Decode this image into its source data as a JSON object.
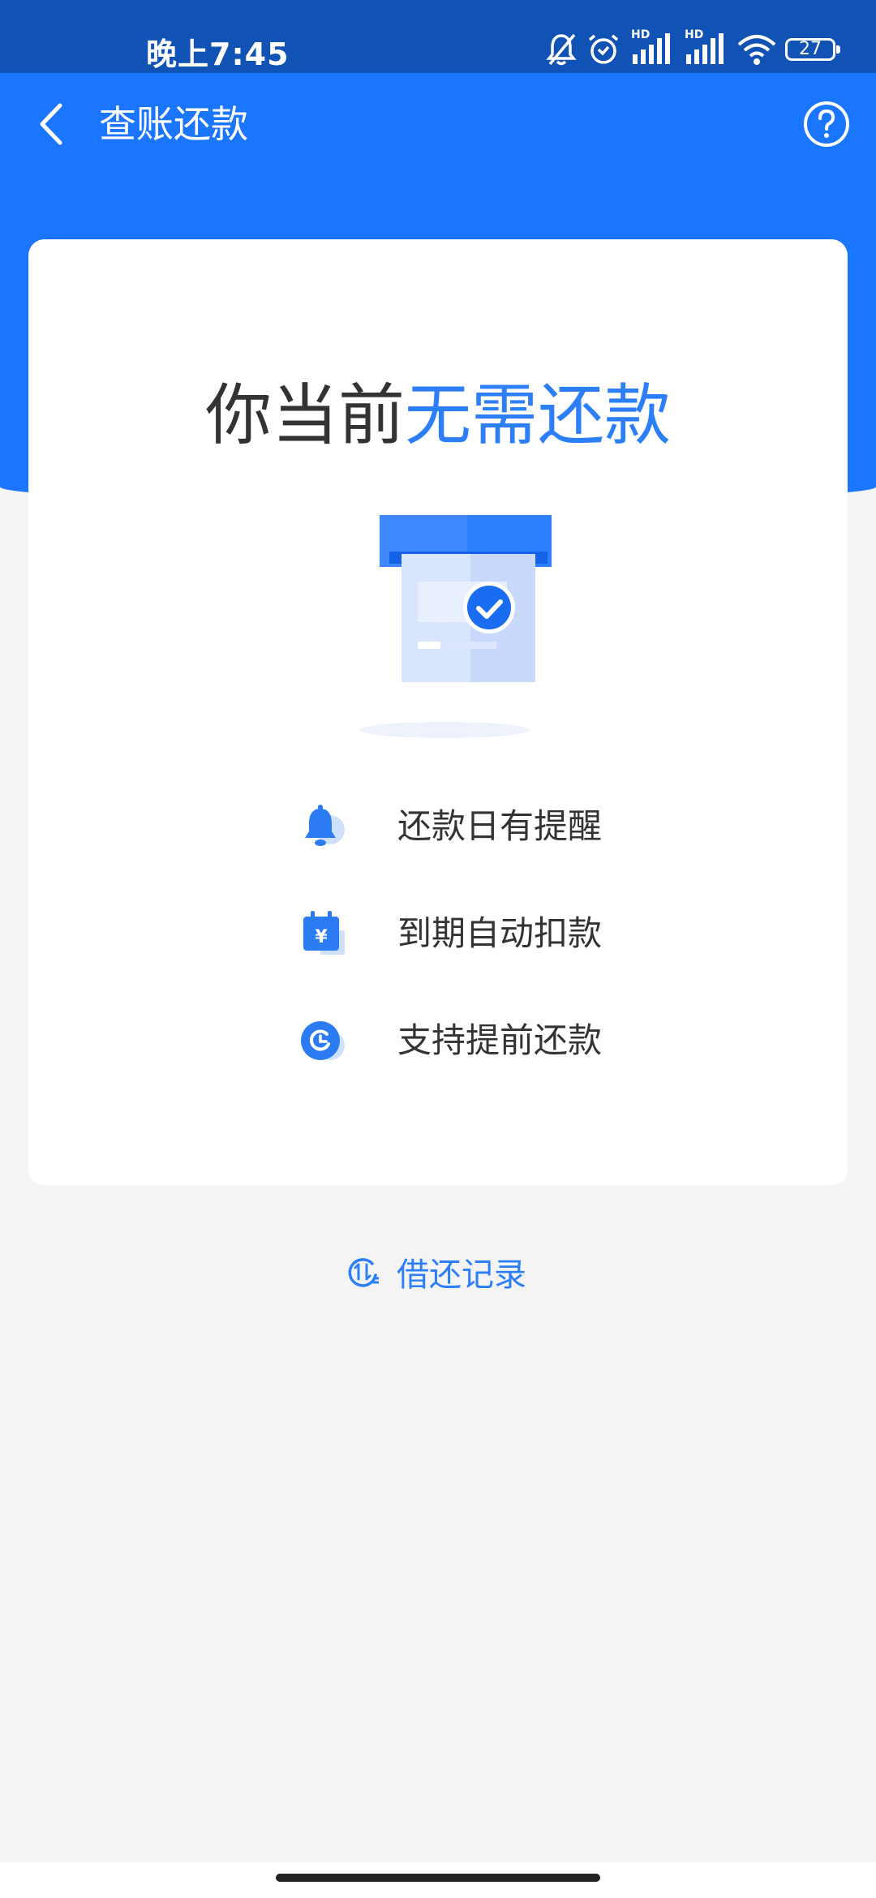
{
  "status_bar": {
    "time": "晚上7:45",
    "icons": [
      "bell-off-icon",
      "alarm-icon",
      "signal-hd-icon",
      "signal-hd-icon",
      "wifi-icon",
      "battery-icon"
    ],
    "hd_label": "HD",
    "battery_level": "27"
  },
  "header": {
    "title": "查账还款",
    "back_icon": "back-arrow-icon",
    "help_icon": "help-icon"
  },
  "card": {
    "headline_prefix": "你当前",
    "headline_emphasis": "无需还款",
    "features": [
      {
        "icon": "bell-icon",
        "label": "还款日有提醒"
      },
      {
        "icon": "calendar-yen-icon",
        "label": "到期自动扣款"
      },
      {
        "icon": "clock-icon",
        "label": "支持提前还款"
      }
    ]
  },
  "records_link": {
    "icon": "transfer-icon",
    "label": "借还记录"
  },
  "colors": {
    "primary": "#1a76ff",
    "status_bar": "#1152b5",
    "accent_text": "#2d7ff9",
    "background": "#f4f4f4"
  }
}
